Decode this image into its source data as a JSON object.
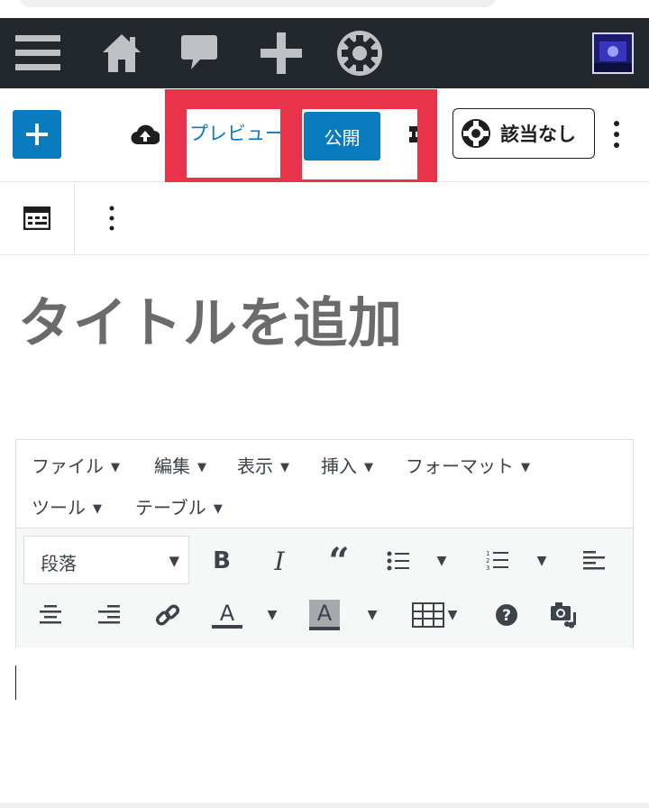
{
  "admin_bar": {
    "icons": [
      "menu-icon",
      "home-icon",
      "comment-icon",
      "plus-icon",
      "plugin-gear-icon",
      "avatar"
    ]
  },
  "editor_header": {
    "add_block_icon": "plus-icon",
    "save_icon": "cloud-upload-icon",
    "preview_label": "プレビュー",
    "publish_label": "公開",
    "settings_label": "該当なし",
    "more_icon": "vertical-ellipsis-icon"
  },
  "block_toolbar": {
    "block_icon": "classic-block-icon",
    "more_icon": "vertical-ellipsis-icon"
  },
  "post": {
    "title_placeholder": "タイトルを追加"
  },
  "classic_editor": {
    "menus": [
      {
        "label": "ファイル"
      },
      {
        "label": "編集"
      },
      {
        "label": "表示"
      },
      {
        "label": "挿入"
      },
      {
        "label": "フォーマット"
      },
      {
        "label": "ツール"
      },
      {
        "label": "テーブル"
      }
    ],
    "format_select_value": "段落",
    "toolbar_icons": [
      "bold-icon",
      "italic-icon",
      "blockquote-icon",
      "bullet-list-icon",
      "numbered-list-icon",
      "align-left-icon",
      "align-center-icon",
      "align-right-icon",
      "link-icon",
      "text-color-icon",
      "background-color-icon",
      "table-icon",
      "help-icon",
      "media-icon"
    ]
  },
  "colors": {
    "admin_bar": "#23282d",
    "accent": "#0b7bc0",
    "highlight": "#e8334a"
  }
}
